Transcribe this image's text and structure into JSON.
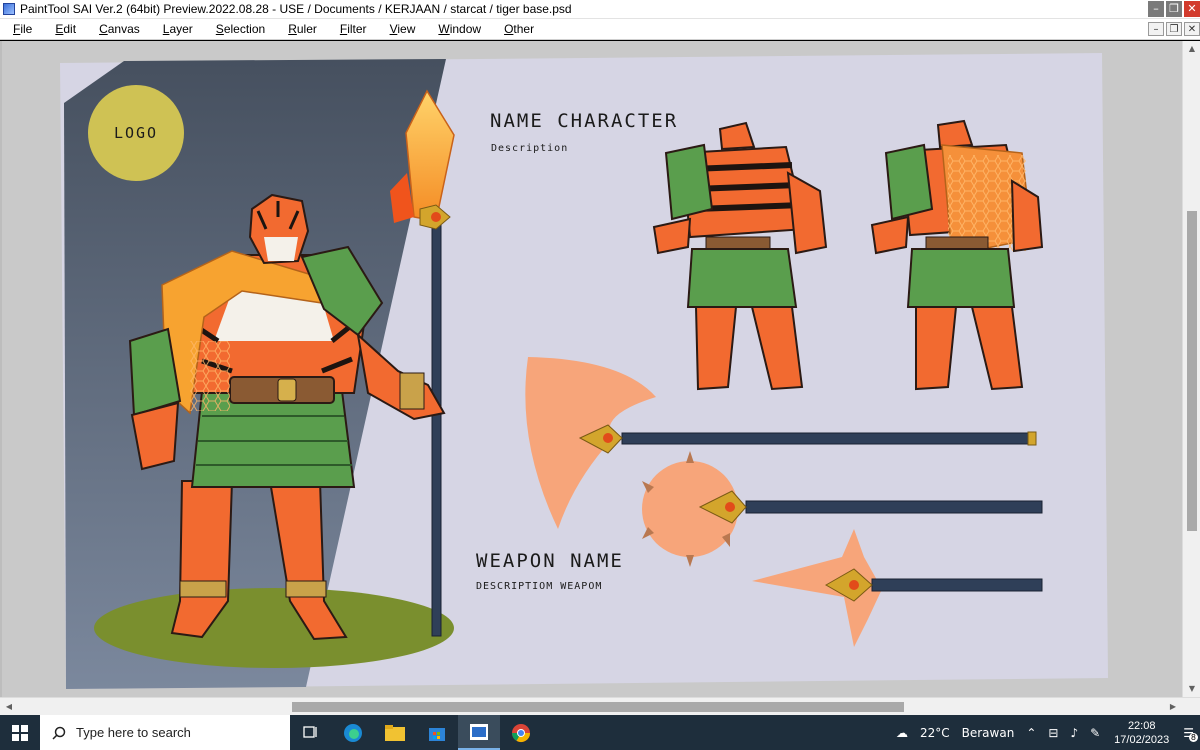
{
  "window": {
    "title": "PaintTool SAI Ver.2 (64bit) Preview.2022.08.28 - USE / Documents / KERJAAN / starcat / tiger base.psd"
  },
  "menu": [
    "File",
    "Edit",
    "Canvas",
    "Layer",
    "Selection",
    "Ruler",
    "Filter",
    "View",
    "Window",
    "Other"
  ],
  "canvas": {
    "logo_text": "LOGO",
    "name_title": "NAME CHARACTER",
    "name_desc": "Description",
    "weapon_title": "WEAPON NAME",
    "weapon_desc": "DESCRIPTIOM WEAPOM"
  },
  "taskbar": {
    "search_placeholder": "Type here to search",
    "weather": "22°C",
    "weather_desc": "Berawan",
    "time": "22:08",
    "date": "17/02/2023",
    "notification_count": "8"
  },
  "colors": {
    "canvas_bg": "#d6d5e4",
    "dark_panel": "#4a5567",
    "logo_circle": "#cfc254",
    "weapon_blade": "#f7a57a",
    "tiger_orange": "#f26a30",
    "armor_green": "#5a9e4d",
    "shaft": "#2f3f58",
    "taskbar": "#1e2e3c"
  }
}
